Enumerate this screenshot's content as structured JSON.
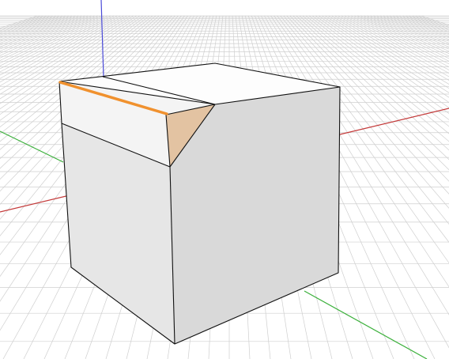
{
  "viewport": {
    "background_color": "#ffffff",
    "grid_color": "#cfcfcf",
    "axis_colors": {
      "x": "#c43a3a",
      "y": "#3bb03b",
      "z": "#4a4ad8"
    }
  },
  "model": {
    "shape": "box with chamfered corner",
    "colors": {
      "front_face": "#e6e6e6",
      "right_face": "#d9d9d9",
      "top_face": "#fdfdfd",
      "front_strip": "#f4f4f4",
      "chamfer_face": "#e3c3a2",
      "selected_edge": "#f0912e",
      "outline": "#111111"
    }
  }
}
